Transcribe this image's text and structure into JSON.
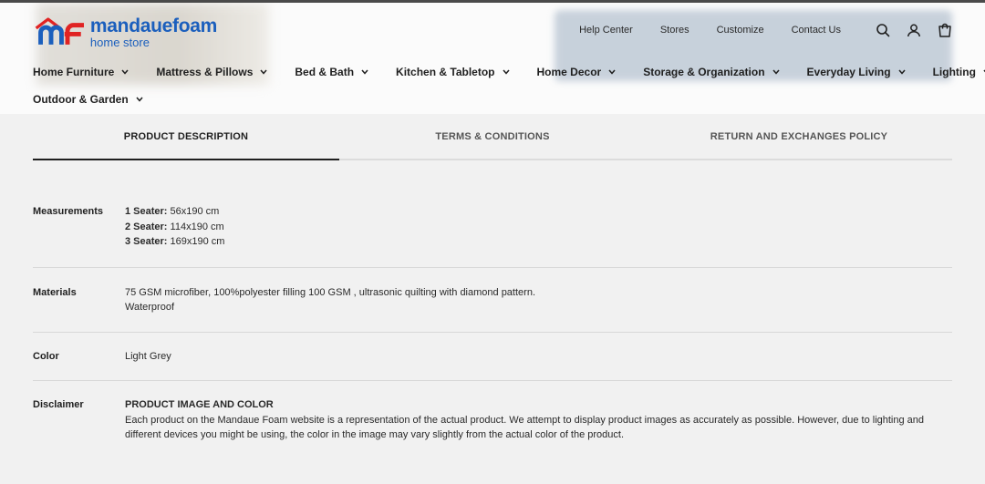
{
  "brand": {
    "name": "mandauefoam",
    "subtitle": "home store",
    "colors": {
      "primary_blue": "#1b5fbd",
      "accent_red": "#e02323"
    }
  },
  "util_nav": {
    "links": [
      "Help Center",
      "Stores",
      "Customize",
      "Contact Us"
    ],
    "icons": [
      "search-icon",
      "account-icon",
      "cart-icon"
    ]
  },
  "main_nav": {
    "row1": [
      "Home Furniture",
      "Mattress & Pillows",
      "Bed & Bath",
      "Kitchen & Tabletop",
      "Home Decor",
      "Storage & Organization",
      "Everyday Living",
      "Lighting"
    ],
    "row2": [
      "Outdoor & Garden"
    ]
  },
  "tabs": {
    "items": [
      "PRODUCT DESCRIPTION",
      "TERMS & CONDITIONS",
      "RETURN AND EXCHANGES POLICY"
    ],
    "active": "PRODUCT DESCRIPTION"
  },
  "specs": {
    "measurements": {
      "label": "Measurements",
      "lines": [
        {
          "key": "1 Seater:",
          "value": " 56x190 cm"
        },
        {
          "key": "2 Seater:",
          "value": " 114x190 cm"
        },
        {
          "key": "3 Seater:",
          "value": " 169x190 cm"
        }
      ]
    },
    "materials": {
      "label": "Materials",
      "line1": "75 GSM microfiber, 100%polyester filling 100 GSM , ultrasonic quilting with diamond pattern.",
      "line2": "Waterproof"
    },
    "color": {
      "label": "Color",
      "value": "Light Grey"
    },
    "disclaimer": {
      "label": "Disclaimer",
      "heading": "PRODUCT IMAGE AND COLOR",
      "text": "Each product on the Mandaue Foam website is a representation of the actual product. We attempt to display product images as accurately as possible. However, due to lighting and different devices you might be using, the color in the image may vary slightly from the actual color of the product."
    }
  }
}
